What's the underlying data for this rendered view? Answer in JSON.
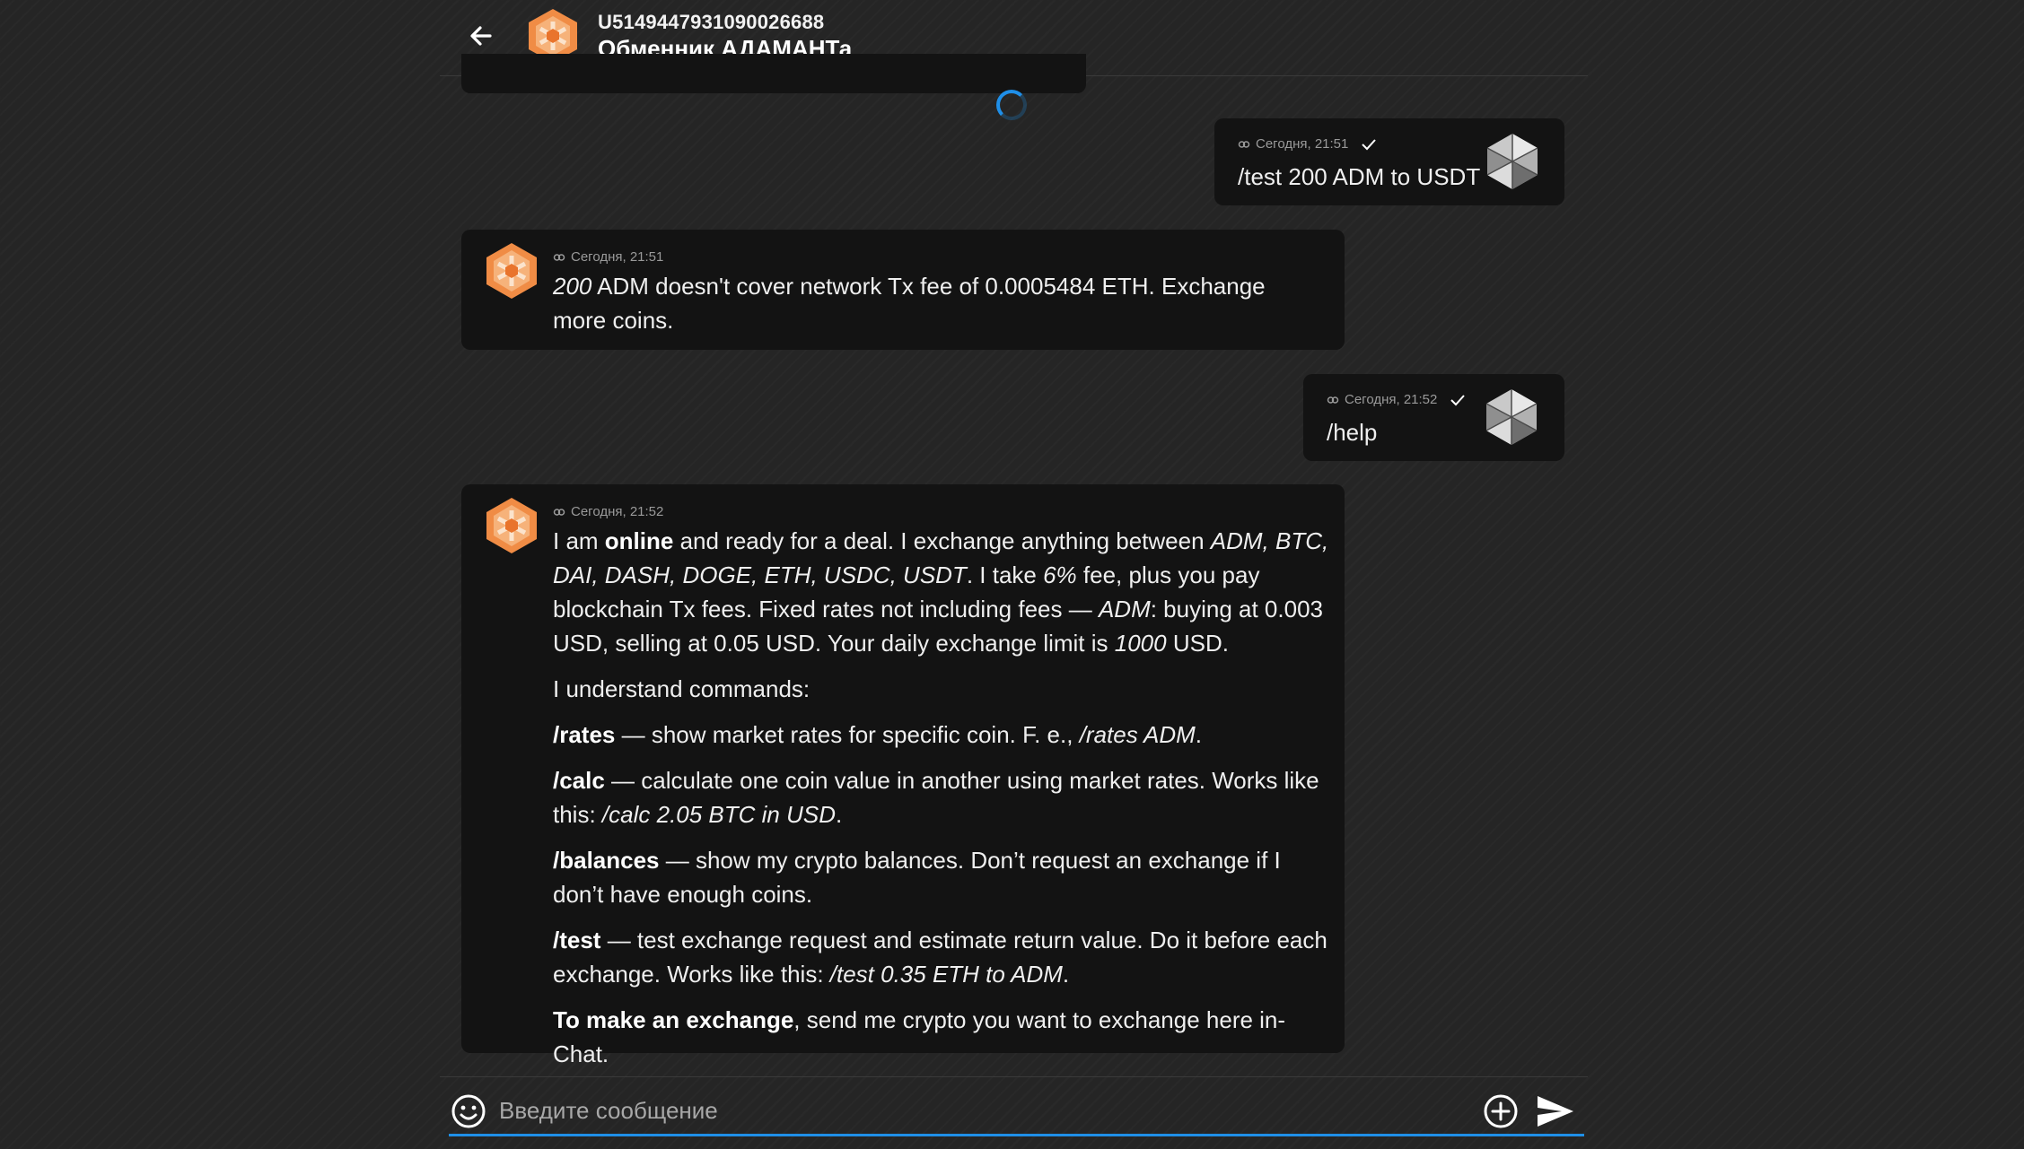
{
  "header": {
    "user_id": "U5149447931090026688",
    "chat_name": "Обменник АДАМАНТа"
  },
  "colors": {
    "background": "#252525",
    "bubble": "#131313",
    "accent": "#1f8fe8",
    "bot_avatar": "#f08c45"
  },
  "messages": [
    {
      "direction": "outgoing",
      "time": "Сегодня, 21:51",
      "text": "/test 200 ADM to USDT"
    },
    {
      "direction": "incoming",
      "time": "Сегодня, 21:51",
      "amount": "200",
      "text_rest": " ADM doesn't cover network Tx fee of 0.0005484 ETH. Exchange more coins."
    },
    {
      "direction": "outgoing",
      "time": "Сегодня, 21:52",
      "text": "/help"
    },
    {
      "direction": "incoming",
      "time": "Сегодня, 21:52",
      "p1": {
        "a": "I am ",
        "online": "online",
        "b": " and ready for a deal. I exchange anything between ",
        "coins": "ADM, BTC, DAI, DASH, DOGE, ETH, USDC, USDT",
        "c": ". I take ",
        "fee": "6%",
        "d": " fee, plus you pay blockchain Tx fees. Fixed rates not including fees — ",
        "adm": "ADM",
        "e": ": buying at 0.003 USD, selling at 0.05 USD. Your daily exchange limit is ",
        "limit": "1000",
        "f": " USD."
      },
      "p2": "I understand commands:",
      "p3": {
        "cmd": "/rates",
        "text": " — show market rates for specific coin. F. e., ",
        "example": "/rates ADM",
        "end": "."
      },
      "p4": {
        "cmd": "/calc",
        "text": " — calculate one coin value in another using market rates. Works like this: ",
        "example": "/calc 2.05 BTC in USD",
        "end": "."
      },
      "p5": {
        "cmd": "/balances",
        "text": " — show my crypto balances. Don’t request an exchange if I don’t have enough coins."
      },
      "p6": {
        "cmd": "/test",
        "text": " — test exchange request and estimate return value. Do it before each exchange. Works like this: ",
        "example": "/test 0.35 ETH to ADM",
        "end": "."
      },
      "p7": {
        "bold": "To make an exchange",
        "text": ", send me crypto you want to exchange here in-Chat."
      }
    }
  ],
  "input": {
    "placeholder": "Введите сообщение"
  }
}
